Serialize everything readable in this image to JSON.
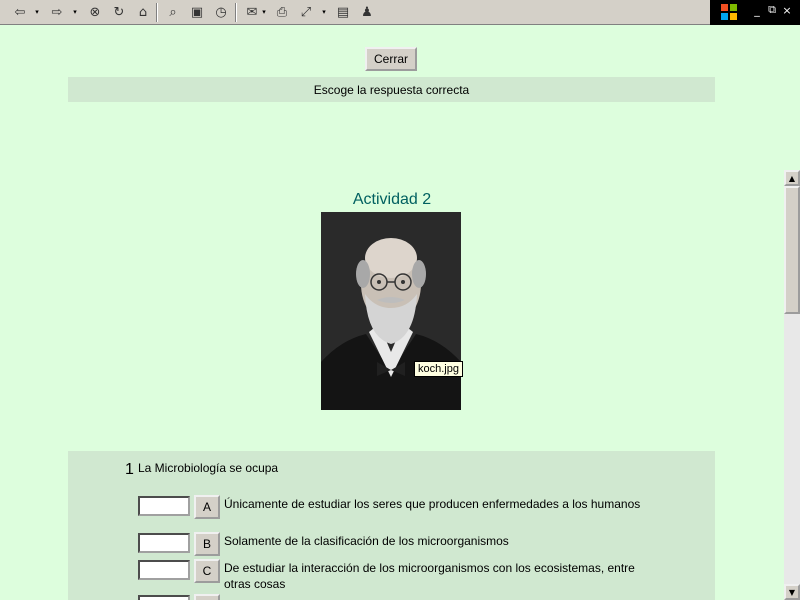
{
  "toolbar": {
    "icons": [
      "back-icon",
      "forward-icon",
      "stop-icon",
      "refresh-icon",
      "home-icon",
      "search-icon",
      "favorites-icon",
      "history-icon",
      "mail-icon",
      "print-icon",
      "fullscreen-icon",
      "edit-icon",
      "messenger-icon"
    ],
    "glyphs": {
      "back": "⇦",
      "drop": "▾",
      "forward": "⇨",
      "stop": "⊗",
      "refresh": "↻",
      "home": "⌂",
      "search": "⌕",
      "favorites": "▣",
      "history": "◷",
      "mail": "✉",
      "print": "⎙",
      "fullscreen": "⤢",
      "edit": "▤",
      "messenger": "♟"
    }
  },
  "window_controls": {
    "minimize": "_",
    "restore": "⧉",
    "close": "×"
  },
  "close_button": {
    "label": "Cerrar"
  },
  "instruction": "Escoge la respuesta correcta",
  "activity": {
    "title": "Actividad 2",
    "image_tooltip": "koch.jpg"
  },
  "question": {
    "number": "1",
    "text": "La Microbiología se ocupa",
    "options": [
      {
        "letter": "A",
        "text": "Únicamente de estudiar los seres que producen enfermedades a los humanos"
      },
      {
        "letter": "B",
        "text": "Solamente de la clasificación de los microorganismos"
      },
      {
        "letter": "C",
        "text": "De estudiar la interacción de los microorganismos con los ecosistemas, entre otras cosas"
      }
    ]
  },
  "scrollbar": {
    "up": "▲",
    "down": "▼"
  },
  "colors": {
    "page_bg": "#ddfedd",
    "panel_bg": "#d0e8d0",
    "title": "#006060"
  }
}
